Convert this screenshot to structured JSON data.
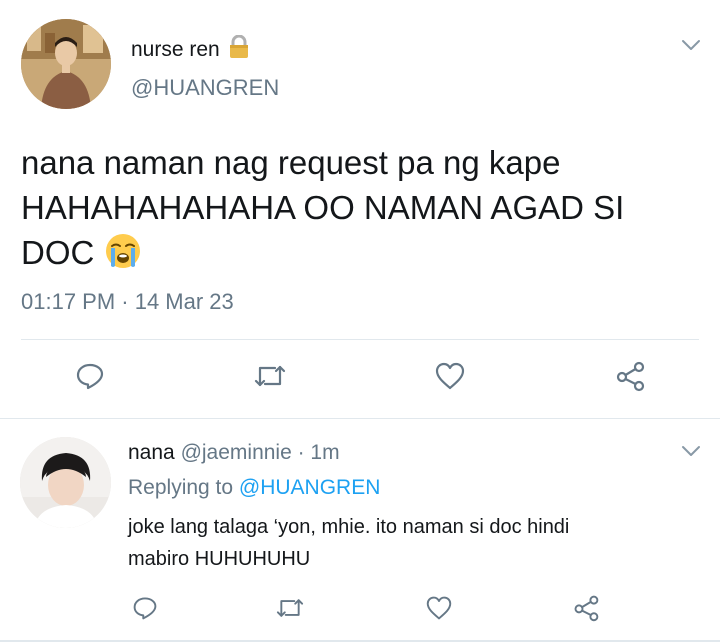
{
  "main_tweet": {
    "display_name": "nurse ren",
    "lock_emoji": "🔒",
    "handle": "@HUANGREN",
    "text_line1": "nana naman nag request pa ng kape",
    "text_line2": "HAHAHAHAHAHA OO NAMAN AGAD SI",
    "text_line3": "DOC",
    "emoji": "😭",
    "timestamp": "01:17 PM · 14 Mar 23"
  },
  "reply_tweet": {
    "display_name": "nana",
    "handle_time": "@jaeminnie · 1m",
    "replying_prefix": "Replying to",
    "replying_mention": "@HUANGREN",
    "text_line1": "joke lang talaga ‘yon, mhie. ito naman si doc hindi",
    "text_line2": "mabiro HUHUHUHU"
  },
  "icons": {
    "reply": "reply-icon",
    "retweet": "retweet-icon",
    "like": "heart-icon",
    "share": "share-icon",
    "more": "chevron-down-icon",
    "lock": "lock-icon"
  },
  "colors": {
    "text": "#14171a",
    "secondary": "#657786",
    "link": "#1da1f2",
    "divider": "#e1e8ed"
  }
}
